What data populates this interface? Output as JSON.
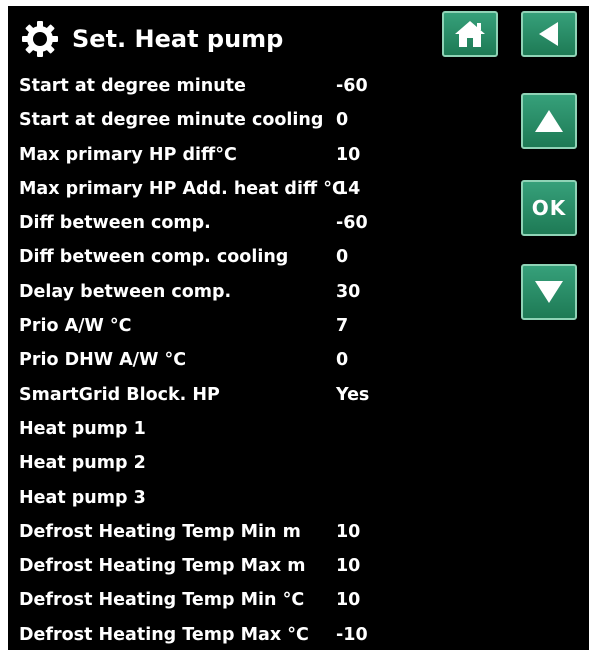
{
  "header": {
    "title": "Set. Heat pump"
  },
  "buttons": {
    "ok_label": "OK"
  },
  "rows": [
    {
      "label": "Start at degree minute",
      "value": "-60"
    },
    {
      "label": "Start at degree minute cooling",
      "value": "0"
    },
    {
      "label": "Max primary HP diff°C",
      "value": "10"
    },
    {
      "label": "Max primary HP Add. heat diff °C",
      "value": "14"
    },
    {
      "label": "Diff between comp.",
      "value": "-60"
    },
    {
      "label": "Diff between comp. cooling",
      "value": "0"
    },
    {
      "label": "Delay between comp.",
      "value": "30"
    },
    {
      "label": "Prio A/W °C",
      "value": "7"
    },
    {
      "label": "Prio DHW A/W °C",
      "value": "0"
    },
    {
      "label": "SmartGrid Block. HP",
      "value": "Yes"
    },
    {
      "label": "Heat pump 1",
      "value": ""
    },
    {
      "label": "Heat pump 2",
      "value": ""
    },
    {
      "label": "Heat pump 3",
      "value": ""
    },
    {
      "label": "Defrost Heating Temp Min m",
      "value": "10"
    },
    {
      "label": "Defrost Heating Temp Max m",
      "value": "10"
    },
    {
      "label": "Defrost Heating Temp Min °C",
      "value": "10"
    },
    {
      "label": "Defrost Heating Temp Max °C",
      "value": "-10"
    }
  ],
  "icons": {
    "header": "gear-icon",
    "home": "home-icon",
    "back": "back-arrow-icon",
    "up": "up-arrow-icon",
    "down": "down-arrow-icon"
  },
  "colors": {
    "background": "#000000",
    "text": "#ffffff",
    "button": "#2a8c66",
    "button_border": "#8fd3b6"
  }
}
